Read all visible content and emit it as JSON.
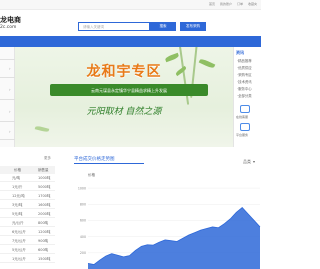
{
  "topbar": {
    "links": [
      "首页",
      "我的账户",
      "订单",
      "收藏夹"
    ]
  },
  "header": {
    "logo_main": "龙电商",
    "logo_sub": "2c.com",
    "search_placeholder": "请输入关键词",
    "search_button": "搜索",
    "purchase_button": "发布采购"
  },
  "banner": {
    "title": "龙和宇专区",
    "strip": "云南元谋县永定镇华宁县精益求精上升发展",
    "slogan": "元阳取材 自然之源"
  },
  "side_panel": {
    "heading": "资讯",
    "items": [
      "·精品推荐",
      "·优质供应",
      "·采购专区",
      "·技术资讯",
      "·服务中心",
      "·全部分类"
    ],
    "icon_labels": [
      "在线客服",
      "平台服务"
    ]
  },
  "price_table": {
    "title": "更多",
    "headers": [
      "价格",
      "销售量"
    ],
    "rows": [
      {
        "name": "元/吨",
        "value": "1000吨"
      },
      {
        "name": "1元/斤",
        "value": "5000吨"
      },
      {
        "name": "12元/吨",
        "value": "1700吨"
      },
      {
        "name": "3元/吨",
        "value": "1600吨"
      },
      {
        "name": "5元/吨",
        "value": "2000吨"
      },
      {
        "name": "元/公斤",
        "value": "800吨"
      },
      {
        "name": "6元/公斤",
        "value": "1200吨"
      },
      {
        "name": "7元/公斤",
        "value": "900吨"
      },
      {
        "name": "5元/公斤",
        "value": "600吨"
      },
      {
        "name": "1元/公斤",
        "value": "1500吨"
      }
    ]
  },
  "chart_header": {
    "title": "平台成交价格走势图",
    "right_label": "品类",
    "caret": "▾"
  },
  "chart_data": {
    "type": "area",
    "ylabel": "价格",
    "yticks": [
      "1000",
      "800",
      "600",
      "400",
      "200"
    ],
    "ylim": [
      0,
      1100
    ],
    "grid": true,
    "x": [
      0,
      1,
      2,
      3,
      4,
      5,
      6,
      7,
      8,
      9,
      10,
      11,
      12,
      13,
      14,
      15,
      16,
      17,
      18,
      19,
      20,
      21,
      22,
      23,
      24,
      25,
      26,
      27,
      28,
      29
    ],
    "values": [
      70,
      55,
      110,
      160,
      190,
      170,
      150,
      165,
      230,
      280,
      300,
      295,
      330,
      360,
      350,
      340,
      380,
      420,
      450,
      480,
      500,
      520,
      510,
      560,
      620,
      700,
      760,
      680,
      600,
      520
    ],
    "color": "#2e68d8"
  }
}
